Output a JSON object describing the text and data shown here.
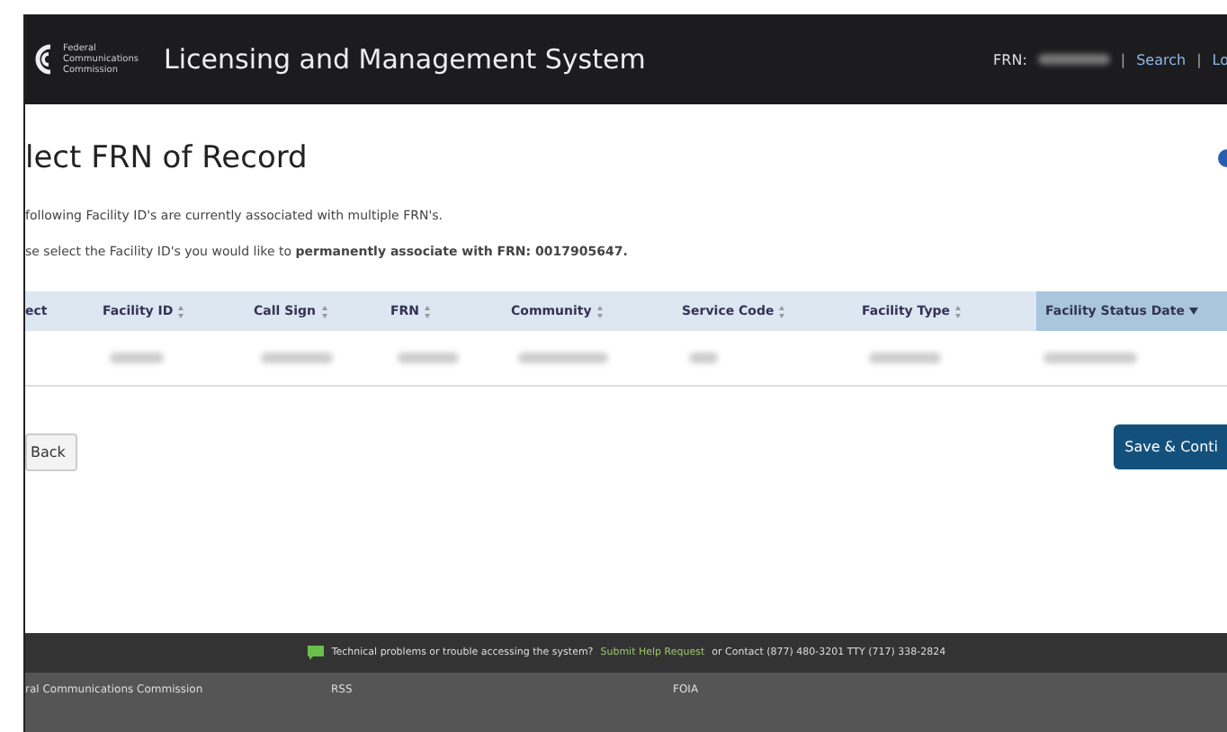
{
  "header": {
    "logo_text": [
      "Federal",
      "Communications",
      "Commission"
    ],
    "title": "Licensing and Management System",
    "frn_label": "FRN:",
    "separator": "|",
    "links": [
      "Search",
      "Lo"
    ]
  },
  "page": {
    "title": "lect FRN of Record",
    "lines": [
      "following Facility ID's are currently associated with multiple FRN's.",
      "se select the Facility ID's you would like to **permanently associate with FRN: 0017905647.**"
    ]
  },
  "table": {
    "columns": [
      {
        "label": "ect",
        "sortable": false,
        "selected": false
      },
      {
        "label": "Facility ID",
        "sortable": true,
        "selected": false
      },
      {
        "label": "Call Sign",
        "sortable": true,
        "selected": false
      },
      {
        "label": "FRN",
        "sortable": true,
        "selected": false
      },
      {
        "label": "Community",
        "sortable": true,
        "selected": false
      },
      {
        "label": "Service Code",
        "sortable": true,
        "selected": false
      },
      {
        "label": "Facility Type",
        "sortable": true,
        "selected": false
      },
      {
        "label": "Facility Status Date",
        "selected": true
      }
    ]
  },
  "buttons": {
    "back": "Back",
    "save": "Save & Conti"
  },
  "footer": {
    "help_text": "Technical problems or trouble accessing the system?",
    "help_link": "Submit Help Request",
    "contact": "or Contact (877) 480-3201 TTY (717) 338-2824",
    "links": [
      "ral Communications Commission",
      "RSS",
      "FOIA"
    ]
  }
}
